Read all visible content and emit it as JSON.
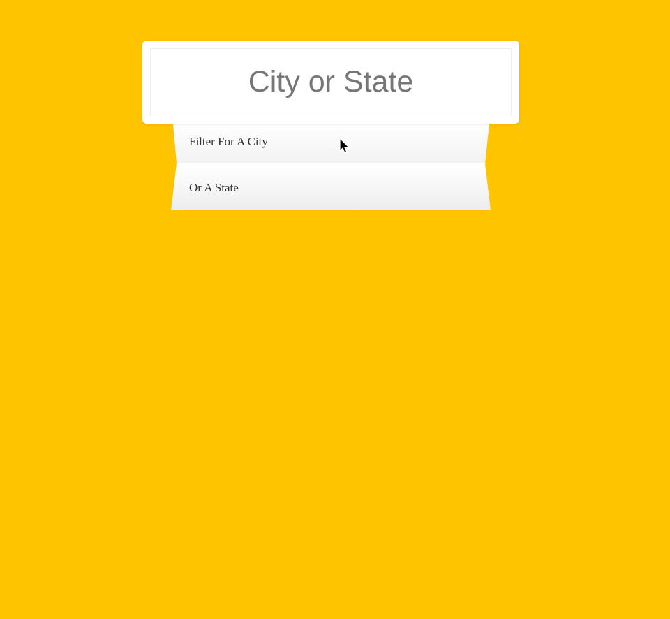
{
  "search": {
    "placeholder": "City or State",
    "value": ""
  },
  "suggestions": [
    {
      "label": "Filter For A City"
    },
    {
      "label": "Or A State"
    }
  ],
  "colors": {
    "background": "#ffc400",
    "card": "#ffffff",
    "placeholder_text": "#777777",
    "item_text": "#333333"
  },
  "icons": {
    "pointer": "mouse-pointer-icon"
  }
}
